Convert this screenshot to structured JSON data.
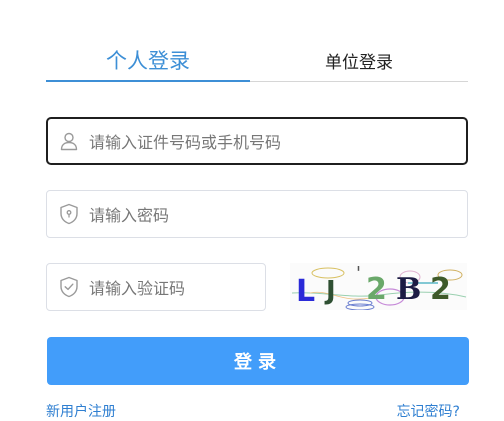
{
  "tabs": {
    "personal": "个人登录",
    "unit": "单位登录"
  },
  "fields": {
    "id_placeholder": "请输入证件号码或手机号码",
    "password_placeholder": "请输入密码",
    "captcha_placeholder": "请输入验证码"
  },
  "captcha": {
    "text": "LJ'2B2"
  },
  "actions": {
    "login": "登录",
    "register": "新用户注册",
    "forgot_password": "忘记密码?"
  },
  "colors": {
    "accent": "#3d8fd6",
    "button": "#429dfa",
    "link": "#2f7fd1"
  },
  "icons": {
    "id_field": "user-icon",
    "password_field": "shield-lock-icon",
    "captcha_field": "shield-check-icon"
  }
}
